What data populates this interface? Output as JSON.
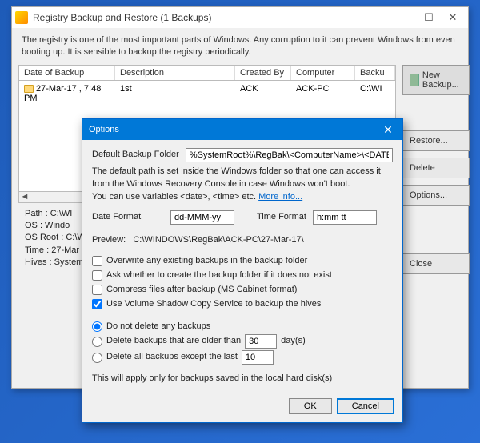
{
  "main": {
    "title": "Registry Backup and Restore  (1 Backups)",
    "intro": "The registry is one of the most important parts of Windows. Any corruption to it can prevent Windows from even booting up.  It is sensible to backup the registry periodically.",
    "columns": {
      "date": "Date of Backup",
      "desc": "Description",
      "created": "Created By",
      "computer": "Computer",
      "backup": "Backu"
    },
    "row": {
      "date": "27-Mar-17 , 7:48 PM",
      "desc": "1st",
      "created": "ACK",
      "computer": "ACK-PC",
      "backup": "C:\\WI"
    },
    "details": {
      "path": "Path      :  C:\\WI",
      "os": "OS          :  Windo",
      "osroot": "OS Root :  C:\\WI",
      "time": "Time       :  27-Mar",
      "hives": "Hives      :  System"
    },
    "buttons": {
      "new": "New Backup...",
      "restore": "Restore...",
      "delete": "Delete",
      "options": "Options...",
      "close": "Close"
    }
  },
  "dialog": {
    "title": "Options",
    "defaultFolderLabel": "Default Backup Folder",
    "defaultFolderValue": "%SystemRoot%\\RegBak\\<ComputerName>\\<DATE>\\",
    "explain1": "The default path is set inside the Windows folder so that one can access it from the Windows Recovery Console in case Windows won't boot.",
    "explain2a": "You can use variables <date>, <time> etc. ",
    "moreInfo": "More info...",
    "dateFormatLabel": "Date Format",
    "dateFormatValue": "dd-MMM-yy",
    "timeFormatLabel": "Time Format",
    "timeFormatValue": "h:mm tt",
    "previewLabel": "Preview:",
    "previewValue": "C:\\WINDOWS\\RegBak\\ACK-PC\\27-Mar-17\\",
    "chkOverwrite": "Overwrite any existing backups in the backup folder",
    "chkAsk": "Ask whether to create the backup folder if it does not exist",
    "chkCompress": "Compress files after backup (MS Cabinet format)",
    "chkVSS": "Use Volume Shadow Copy Service to backup the hives",
    "radNoDelete": "Do not delete any backups",
    "radOlder": "Delete backups that are older than",
    "radOlderVal": "30",
    "radOlderUnit": "day(s)",
    "radExcept": "Delete all backups except the last",
    "radExceptVal": "10",
    "applyNote": "This will apply only for backups saved in the local hard disk(s)",
    "ok": "OK",
    "cancel": "Cancel"
  }
}
